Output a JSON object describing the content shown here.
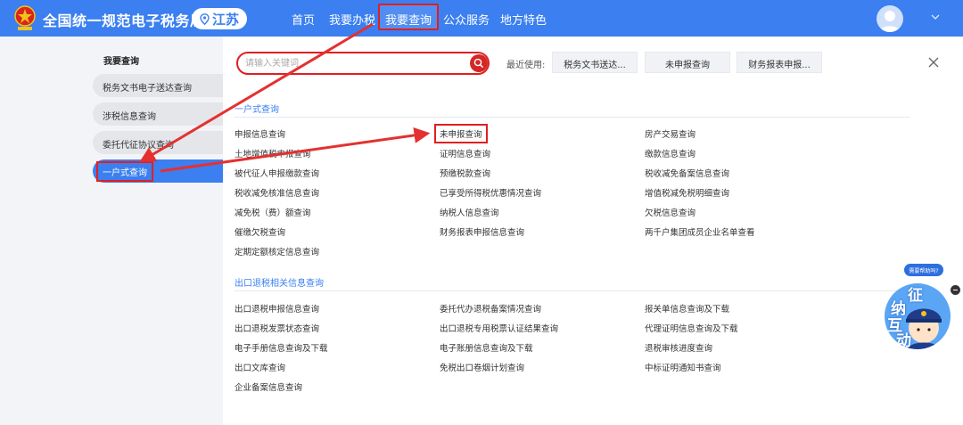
{
  "header": {
    "site_title": "全国统一规范电子税务局",
    "region": "江苏",
    "nav": [
      "首页",
      "我要办税",
      "我要查询",
      "公众服务",
      "地方特色"
    ],
    "active_nav": "我要查询"
  },
  "sidebar": {
    "heading": "我要查询",
    "items": [
      "税务文书电子送达查询",
      "涉税信息查询",
      "委托代征协议查询",
      "一户式查询"
    ],
    "active_item": "一户式查询"
  },
  "search": {
    "placeholder": "请输入关键词"
  },
  "recent": {
    "label": "最近使用:",
    "items": [
      "税务文书送达...",
      "未申报查询",
      "财务报表申报..."
    ]
  },
  "sections": [
    {
      "title": "一户式查询",
      "links": [
        "申报信息查询",
        "未申报查询",
        "房产交易查询",
        "土地增值税申报查询",
        "证明信息查询",
        "缴款信息查询",
        "被代征人申报缴款查询",
        "预缴税款查询",
        "税收减免备案信息查询",
        "税收减免核准信息查询",
        "已享受所得税优惠情况查询",
        "增值税减免税明细查询",
        "减免税（费）额查询",
        "纳税人信息查询",
        "欠税信息查询",
        "催缴欠税查询",
        "财务报表申报信息查询",
        "两千户集团成员企业名单查看",
        "定期定额核定信息查询"
      ],
      "highlighted": "未申报查询"
    },
    {
      "title": "出口退税相关信息查询",
      "links": [
        "出口退税申报信息查询",
        "委托代办退税备案情况查询",
        "报关单信息查询及下载",
        "出口退税发票状态查询",
        "出口退税专用税票认证结果查询",
        "代理证明信息查询及下载",
        "电子手册信息查询及下载",
        "电子账册信息查询及下载",
        "退税审核进度查询",
        "出口文库查询",
        "免税出口卷烟计划查询",
        "中标证明通知书查询",
        "企业备案信息查询"
      ]
    }
  ],
  "helper": {
    "bubble": "需要帮助吗?",
    "chars": [
      "征",
      "纳",
      "互",
      "动"
    ]
  },
  "colors": {
    "brand": "#3b7ff0",
    "highlight": "#e02020",
    "search_button": "#d42727"
  }
}
